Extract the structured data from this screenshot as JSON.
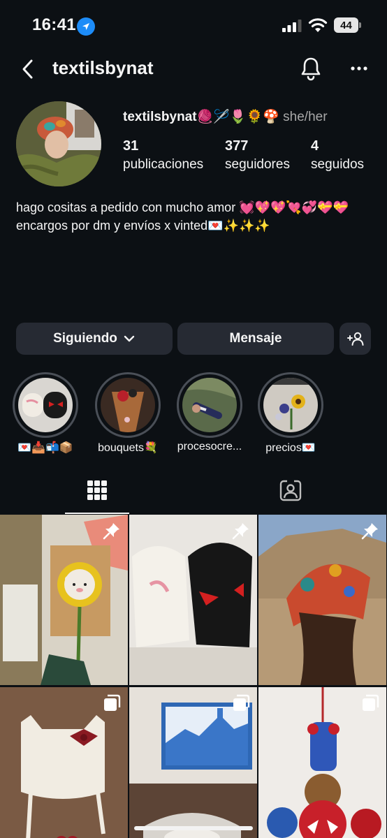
{
  "status": {
    "time": "16:41",
    "battery": "44"
  },
  "header": {
    "title": "textilsbynat"
  },
  "profile": {
    "username": "textilsbynat",
    "name_emojis": "🧶🪡🌷🌻🍄",
    "pronouns": "she/her",
    "stats": [
      {
        "value": "31",
        "label": "publicaciones"
      },
      {
        "value": "377",
        "label": "seguidores"
      },
      {
        "value": "4",
        "label": "seguidos"
      }
    ],
    "bio_line1": "hago cositas a pedido con mucho amor 💓💖💖💘💞💝💝",
    "bio_line2": "encargos por dm y envíos x vinted💌✨✨✨"
  },
  "actions": {
    "follow_label": "Siguiendo",
    "message_label": "Mensaje"
  },
  "highlights": [
    {
      "label": "💌📥📬📦"
    },
    {
      "label": "bouquets💐"
    },
    {
      "label": "procesocre..."
    },
    {
      "label": "precios💌"
    }
  ],
  "icons": {
    "location": "location-arrow-icon",
    "signal": "cellular-signal-icon",
    "wifi": "wifi-icon",
    "back": "chevron-left-icon",
    "bell": "bell-icon",
    "more": "more-horizontal-icon",
    "grid": "grid-icon",
    "tagged": "tagged-person-icon",
    "pin": "pin-icon",
    "carousel": "carousel-icon"
  },
  "colors": {
    "background": "#0c1014",
    "button": "#262a33",
    "accent": "#1d8cf8"
  }
}
